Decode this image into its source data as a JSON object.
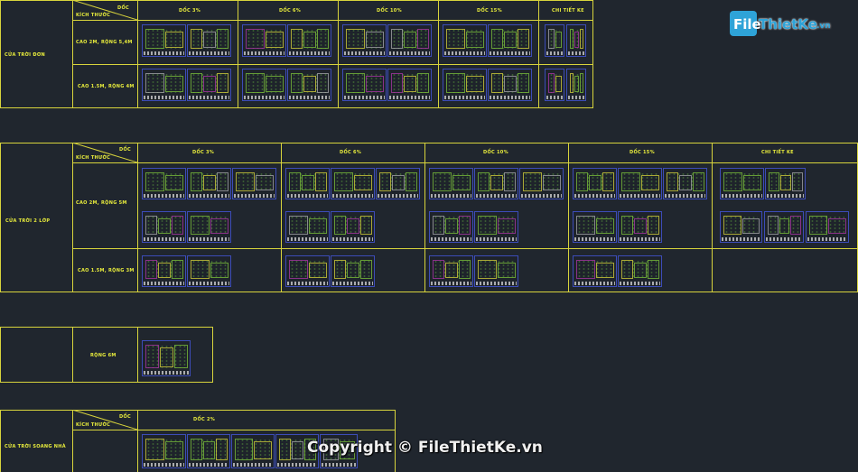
{
  "header_corner": {
    "top": "DỐC",
    "bottom": "KÍCH THƯỚC"
  },
  "table1": {
    "row_title": "CỬA TRỜI ĐƠN",
    "cols": [
      "DỐC 3%",
      "DỐC 6%",
      "DỐC 10%",
      "DỐC 15%",
      "CHI TIẾT KE"
    ],
    "rows": [
      "CAO 2M, RỘNG 5,4M",
      "CAO 1.5M, RỘNG 4M"
    ]
  },
  "table2": {
    "row_title": "CỬA TRỜI 2 LỚP",
    "cols": [
      "DỐC 3%",
      "DỐC 6%",
      "DỐC 10%",
      "DỐC 15%",
      "CHI TIẾT KE"
    ],
    "rows": [
      "CAO 2M, RỘNG 5M",
      "CAO 1.5M, RỘNG 3M"
    ]
  },
  "table3": {
    "row_label": "RỘNG 6M"
  },
  "table4": {
    "row_title": "CỬA TRỜI SOANG NHÀ",
    "cols": [
      "DỐC 2%"
    ]
  },
  "watermark": {
    "logo_file": "File",
    "logo_name": "ThietKe",
    "logo_tld": ".vn",
    "copyright": "Copyright © FileThietKe.vn"
  },
  "colors": {
    "background": "#20262e",
    "grid": "#d8d43c",
    "label": "#e8ec3c",
    "sheet_border": "#3c4cb8",
    "logo_blue": "#2ea3d8"
  }
}
